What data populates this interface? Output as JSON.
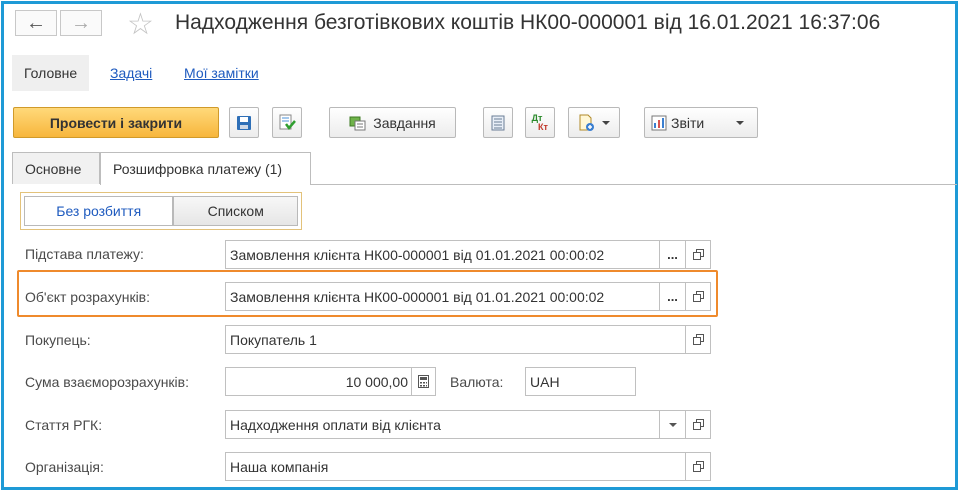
{
  "window": {
    "title": "Надходження безготівкових коштів НК00-000001 від 16.01.2021 16:37:06"
  },
  "command_tabs": [
    {
      "label": "Головне"
    },
    {
      "label": "Задачі"
    },
    {
      "label": "Мої замітки"
    }
  ],
  "toolbar": {
    "post_close_label": "Провести і закрити",
    "tasks_label": "Завдання",
    "reports_label": "Звіти",
    "dtkt_label_top": "Дт",
    "dtkt_label_bottom": "Кт"
  },
  "form_tabs": [
    {
      "label": "Основне"
    },
    {
      "label": "Розшифровка платежу (1)"
    }
  ],
  "view_switch": {
    "option1": "Без розбиття",
    "option2": "Списком",
    "selected": "Без розбиття"
  },
  "fields": {
    "payment_basis": {
      "label": "Підстава платежу:",
      "value": "Замовлення клієнта НК00-000001 від 01.01.2021 00:00:02"
    },
    "settlement_object": {
      "label": "Об'єкт розрахунків:",
      "value": "Замовлення клієнта НК00-000001 від 01.01.2021 00:00:02"
    },
    "buyer": {
      "label": "Покупець:",
      "value": "Покупатель 1"
    },
    "settlement_amount": {
      "label": "Сума взаєморозрахунків:",
      "value": "10 000,00"
    },
    "currency": {
      "label": "Валюта:",
      "value": "UAH"
    },
    "cash_flow_item": {
      "label": "Стаття РГК:",
      "value": "Надходження оплати від клієнта"
    },
    "organization": {
      "label": "Організація:",
      "value": "Наша компанія"
    }
  },
  "colors": {
    "frame": "#1e9ad6",
    "highlight": "#ef8a2c",
    "primary_button": "#f7b63c",
    "link": "#1f5bbf"
  }
}
